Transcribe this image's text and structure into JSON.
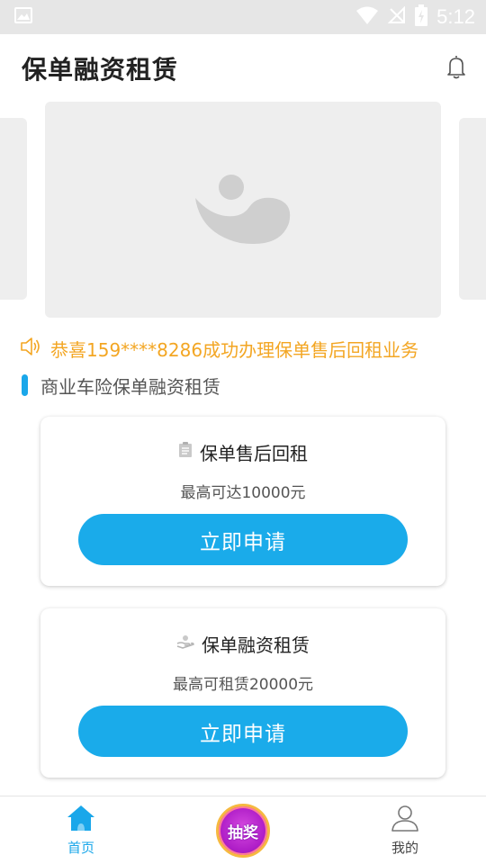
{
  "status_bar": {
    "time": "5:12",
    "icons": [
      "image-icon",
      "wifi-icon",
      "no-signal-icon",
      "battery-charging-icon"
    ]
  },
  "header": {
    "title": "保单融资租赁",
    "bell_icon": "bell-icon"
  },
  "carousel": {
    "placeholder_icon": "image-placeholder-icon"
  },
  "notice": {
    "icon": "speaker-icon",
    "text": "恭喜159****8286成功办理保单售后回租业务",
    "color": "#f3a623"
  },
  "section": {
    "title": "商业车险保单融资租赁"
  },
  "cards": [
    {
      "icon": "document-icon",
      "title": "保单售后回租",
      "subtitle": "最高可达10000元",
      "button_label": "立即申请"
    },
    {
      "icon": "hand-coin-icon",
      "title": "保单融资租赁",
      "subtitle": "最高可租赁20000元",
      "button_label": "立即申请"
    }
  ],
  "bottom_nav": {
    "home_label": "首页",
    "lottery_label": "抽奖",
    "mine_label": "我的"
  },
  "colors": {
    "accent": "#1aabea",
    "notice": "#f3a623"
  }
}
